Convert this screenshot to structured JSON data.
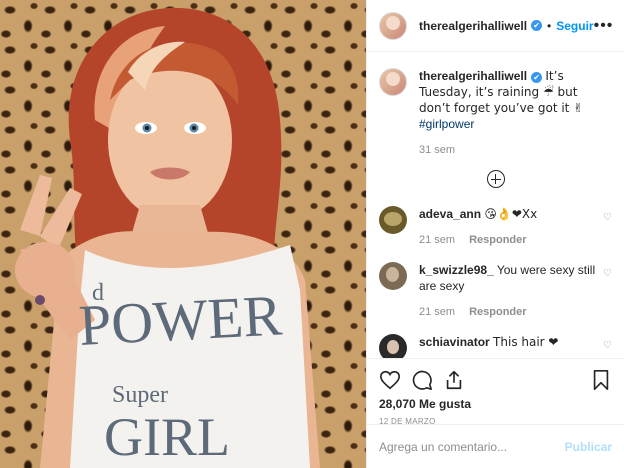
{
  "post": {
    "username": "therealgerihalliwell",
    "verified_mark": "✔",
    "separator": "•",
    "follow_label": "Seguir",
    "more_icon": "more-options-icon"
  },
  "photo": {
    "shirt_line1": "POWER",
    "shirt_line2": "Super",
    "shirt_line3": "GIRL",
    "shirt_partial": "d"
  },
  "caption": {
    "username": "therealgerihalliwell",
    "text": "It’s Tuesday, it’s raining ☔ but don’t forget you’ve got it ✌",
    "hashtag": "#girlpower",
    "time": "31 sem"
  },
  "comments": [
    {
      "username": "adeva_ann",
      "text": "😘👌❤Xx",
      "time": "21 sem",
      "reply": "Responder"
    },
    {
      "username": "k_swizzle98_",
      "text": "You were sexy still are sexy",
      "time": "21 sem",
      "reply": "Responder"
    },
    {
      "username": "schiavinator",
      "text": "This hair ❤",
      "time": "",
      "reply": ""
    }
  ],
  "actions": {
    "likes": "28,070 Me gusta",
    "date": "12 DE MARZO"
  },
  "add_comment": {
    "placeholder": "Agrega un comentario...",
    "post_label": "Publicar"
  },
  "colors": {
    "accent": "#0095f6",
    "verified": "#3897f0",
    "hashtag": "#00376b",
    "heart": "#ed4956"
  }
}
